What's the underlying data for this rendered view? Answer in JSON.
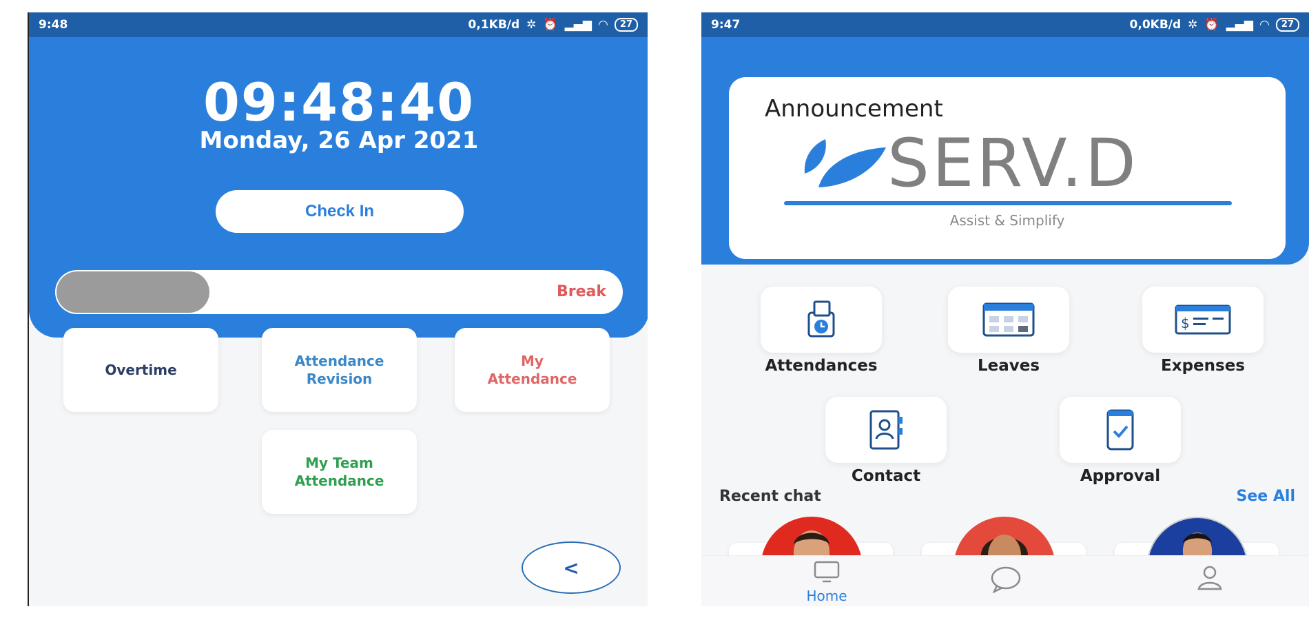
{
  "left": {
    "status": {
      "time": "9:48",
      "info": "0,1KB/d",
      "battery": "27"
    },
    "clock": {
      "time": "09:48:40",
      "date": "Monday, 26 Apr 2021"
    },
    "check_in_label": "Check In",
    "break_label": "Break",
    "tiles": [
      {
        "label_line1": "Overtime",
        "label_line2": "",
        "color": "#2c3e66"
      },
      {
        "label_line1": "Attendance",
        "label_line2": "Revision",
        "color": "#3a87c9"
      },
      {
        "label_line1": "My",
        "label_line2": "Attendance",
        "color": "#e06666"
      },
      {
        "label_line1": "My Team",
        "label_line2": "Attendance",
        "color": "#2f9e4f"
      }
    ],
    "back_label": "<"
  },
  "right": {
    "status": {
      "time": "9:47",
      "info": "0,0KB/d",
      "battery": "27"
    },
    "announcement": {
      "title": "Announcement",
      "brand": "SERV.D",
      "tagline": "Assist & Simplify"
    },
    "menu": [
      {
        "label": "Attendances",
        "icon": "attendance-icon"
      },
      {
        "label": "Leaves",
        "icon": "calendar-icon"
      },
      {
        "label": "Expenses",
        "icon": "expense-icon"
      },
      {
        "label": "Contact",
        "icon": "contact-book-icon"
      },
      {
        "label": "Approval",
        "icon": "approval-phone-icon"
      }
    ],
    "recent_chat": {
      "title": "Recent chat",
      "see_all": "See All"
    },
    "nav": {
      "home": "Home"
    }
  },
  "colors": {
    "primary": "#2b7fdc",
    "status_bar": "#1f5fa8",
    "break": "#e05a5a"
  }
}
